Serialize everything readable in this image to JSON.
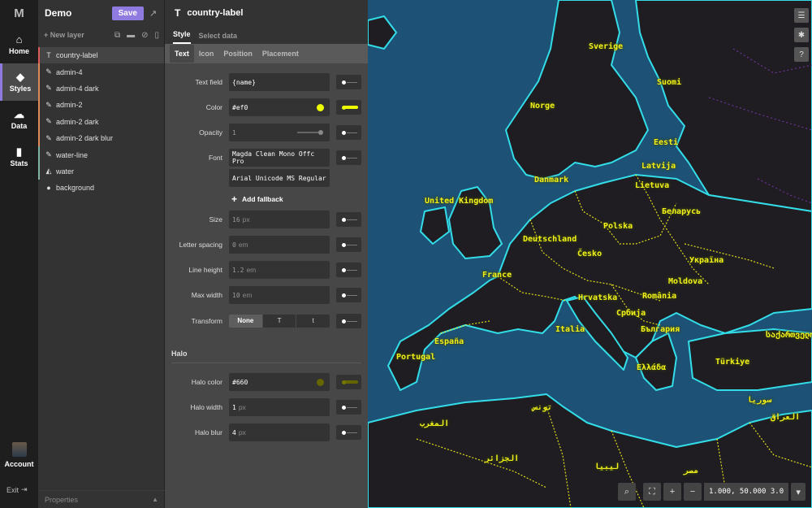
{
  "nav": {
    "logo": "M",
    "items": [
      {
        "label": "Home",
        "icon": "home-icon"
      },
      {
        "label": "Styles",
        "icon": "paint-bucket-icon"
      },
      {
        "label": "Data",
        "icon": "cloud-icon"
      },
      {
        "label": "Stats",
        "icon": "bar-chart-icon"
      }
    ],
    "account": "Account",
    "exit": "Exit"
  },
  "project": {
    "title": "Demo",
    "save": "Save"
  },
  "layers_panel": {
    "new_layer": "New layer",
    "items": [
      {
        "name": "country-label",
        "icon": "T",
        "color": "#e05a5a"
      },
      {
        "name": "admin-4",
        "icon": "pencil",
        "color": "#e08a5a"
      },
      {
        "name": "admin-4 dark",
        "icon": "pencil",
        "color": "#e08a5a"
      },
      {
        "name": "admin-2",
        "icon": "pencil",
        "color": "#e08a5a"
      },
      {
        "name": "admin-2 dark",
        "icon": "pencil",
        "color": "#e08a5a"
      },
      {
        "name": "admin-2 dark blur",
        "icon": "pencil",
        "color": "#e08a5a"
      },
      {
        "name": "water-line",
        "icon": "pencil",
        "color": "#7fb3a8"
      },
      {
        "name": "water",
        "icon": "fill",
        "color": "#7fb3a8"
      },
      {
        "name": "background",
        "icon": "globe",
        "color": "transparent"
      }
    ],
    "properties": "Properties"
  },
  "editor": {
    "layer_name": "country-label",
    "tabs": [
      "Style",
      "Select data"
    ],
    "sub_tabs": [
      "Text",
      "Icon",
      "Position",
      "Placement"
    ],
    "fields": {
      "text_field": {
        "label": "Text field",
        "value": "{name}"
      },
      "color": {
        "label": "Color",
        "value": "#ef0",
        "swatch": "#eeff00"
      },
      "opacity": {
        "label": "Opacity",
        "value": "1"
      },
      "font": {
        "label": "Font",
        "value1": "Magda Clean Mono Offc Pro",
        "value2": "Arial Unicode MS Regular"
      },
      "add_fallback": "Add fallback",
      "size": {
        "label": "Size",
        "value": "16",
        "unit": "px"
      },
      "letter_spacing": {
        "label": "Letter spacing",
        "value": "0",
        "unit": "em"
      },
      "line_height": {
        "label": "Line height",
        "value": "1.2",
        "unit": "em"
      },
      "max_width": {
        "label": "Max width",
        "value": "10",
        "unit": "em"
      },
      "transform": {
        "label": "Transform",
        "options": [
          "None",
          "T",
          "t"
        ],
        "selected": "None"
      }
    },
    "halo": {
      "heading": "Halo",
      "color": {
        "label": "Halo color",
        "value": "#660",
        "swatch": "#666600"
      },
      "width": {
        "label": "Halo width",
        "value": "1",
        "unit": "px"
      },
      "blur": {
        "label": "Halo blur",
        "value": "4",
        "unit": "px"
      }
    }
  },
  "map": {
    "labels": [
      "Sverige",
      "Suomi",
      "Norge",
      "Eesti",
      "Latvija",
      "Danmark",
      "Lietuva",
      "United Kingdom",
      "Беларусь",
      "Polska",
      "Deutschland",
      "Česko",
      "Україна",
      "France",
      "Moldova",
      "Hrvatska",
      "România",
      "Србија",
      "България",
      "Italia",
      "España",
      "Portugal",
      "Ελλάδα",
      "Türkiye",
      "საქართველო",
      "سوريا",
      "العراق",
      "الجزائر",
      "تونس",
      "ليبيا",
      "مصر",
      "المغرب"
    ],
    "coords": "1.000, 50.000 3.0",
    "colors": {
      "water": "#1d5176",
      "land": "#1f1d22",
      "coast": "#33dde8",
      "border": "#f2f21a"
    }
  }
}
